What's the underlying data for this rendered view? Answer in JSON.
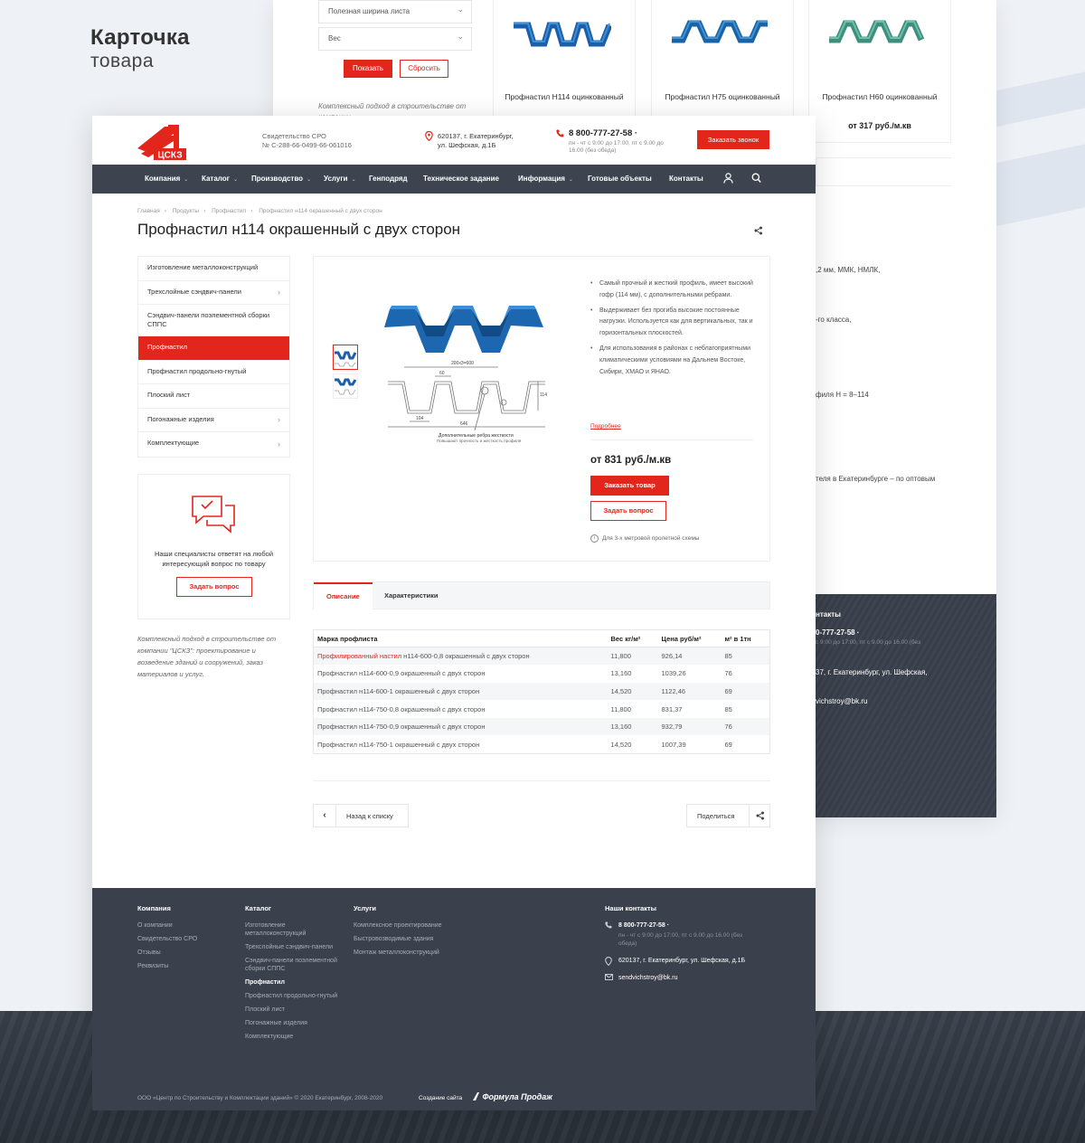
{
  "colors": {
    "accent": "#e3261c",
    "nav": "#3d4450",
    "footer": "#3a414c"
  },
  "presentation": {
    "title": "Карточка",
    "subtitle": "товара"
  },
  "back": {
    "filters": [
      "Полезная ширина листа",
      "Вес"
    ],
    "show_label": "Показать",
    "reset_label": "Сбросить",
    "blurb": "Комплексный подход в строительстве от компании",
    "products": [
      {
        "name": "Профнастил Н114 оцинкованный",
        "price": ""
      },
      {
        "name": "Профнастил Н75 оцинкованный",
        "price": ""
      },
      {
        "name": "Профнастил Н60 оцинкованный",
        "price": "от 317 руб./м.кв"
      }
    ],
    "snippets": [
      ",2 мм, ММК, НМЛК,",
      "-го класса,",
      "филя H = 8–114",
      "теля в Екатеринбурге – по оптовым"
    ],
    "dark": {
      "title": "нтакты",
      "phone": "0-777-27-58 ·",
      "hours": "с 9:00 до 17:00, пт с 9.00 до 16.00 (без",
      "addr": "37, г. Екатеринбург, ул. Шефская,",
      "email": "vichstroy@bk.ru"
    }
  },
  "header": {
    "cert_line1": "Свидетельство СРО",
    "cert_line2": "№ С-288-66-0499-66-061016",
    "addr_line1": "620137, г. Екатеринбург,",
    "addr_line2": "ул. Шефская, д.1Б",
    "phone": "8 800-777-27-58 ·",
    "hours": "пн - чт с 9:00 до 17:00, пт с 9.00 до 16.00 (без обеда)",
    "call_label": "Заказать звонок"
  },
  "nav": [
    {
      "label": "Компания",
      "chev": "⌄"
    },
    {
      "label": "Каталог",
      "chev": "⌄"
    },
    {
      "label": "Производство",
      "chev": "⌄"
    },
    {
      "label": "Услуги",
      "chev": "⌄"
    },
    {
      "label": "Генподряд",
      "chev": ""
    },
    {
      "label": "Техническое задание",
      "chev": ""
    },
    {
      "label": "Информация",
      "chev": "⌄"
    },
    {
      "label": "Готовые объекты",
      "chev": ""
    },
    {
      "label": "Контакты",
      "chev": ""
    }
  ],
  "breadcrumbs": [
    "Главная",
    "Продукты",
    "Профнастил",
    "Профнастил н114 окрашенный с двух сторон"
  ],
  "title": "Профнастил н114 окрашенный с двух сторон",
  "sidebar": [
    {
      "label": "Изготовление металлоконструкций",
      "arrow": ""
    },
    {
      "label": "Трехслойные сэндвич-панели",
      "arrow": "›"
    },
    {
      "label": "Сэндвич-панели поэлементной сборки СППС",
      "arrow": ""
    },
    {
      "label": "Профнастил",
      "arrow": ""
    },
    {
      "label": "Профнастил продольно-гнутый",
      "arrow": ""
    },
    {
      "label": "Плоский лист",
      "arrow": ""
    },
    {
      "label": "Погонажные изделия",
      "arrow": "›"
    },
    {
      "label": "Комплектующие",
      "arrow": "›"
    }
  ],
  "help": {
    "text": "Наши специалисты ответят на любой интересующий вопрос по товару",
    "button": "Задать вопрос"
  },
  "side_blurb": "Комплексный подход в строительстве от компании \"ЦСКЗ\": проектирование и возведение зданий и сооружений, заказ материалов и услуг.",
  "product": {
    "bullets": [
      "Самый прочный и жесткий профиль, имеет высокий гофр (114 мм), с дополнительными ребрами.",
      "Выдерживает без прогиба высокие постоянные нагрузки. Используется как для вертикальных, так и горизонтальных плоскостей.",
      "Для использования в районах с неблагоприятными климатическими условиями на Дальнем Востоке, Сибири, ХМАО и ЯНАО."
    ],
    "more": "Подробнее",
    "price": "от 831 руб./м.кв",
    "order": "Заказать товар",
    "ask": "Задать вопрос",
    "note": "Для 3-х метровой пролетной схемы",
    "drawing": {
      "dim1": "200х3=600",
      "dim2": "60",
      "dim3": "114",
      "dim4": "104",
      "dim5": "646",
      "cap1": "Дополнительные ребра жесткости",
      "cap2": "Повышают прочность и жесткость профиля"
    }
  },
  "tabs": [
    "Описание",
    "Характеристики"
  ],
  "table": {
    "headers": [
      "Марка профлиста",
      "Вес кг/м²",
      "Цена руб/м²",
      "м² в 1тн"
    ],
    "rows": [
      {
        "link": "Профилированный настил",
        "name": " н114-600-0,8 окрашенный с двух сторон",
        "w": "11,800",
        "p": "926,14",
        "q": "85"
      },
      {
        "link": "",
        "name": "Профнастил н114-600-0,9 окрашенный с двух сторон",
        "w": "13,160",
        "p": "1039,26",
        "q": "76"
      },
      {
        "link": "",
        "name": "Профнастил н114-600-1 окрашенный с двух сторон",
        "w": "14,520",
        "p": "1122,46",
        "q": "69"
      },
      {
        "link": "",
        "name": "Профнастил н114-750-0,8 окрашенный с двух сторон",
        "w": "11,800",
        "p": "831,37",
        "q": "85"
      },
      {
        "link": "",
        "name": "Профнастил н114-750-0,9 окрашенный с двух сторон",
        "w": "13,160",
        "p": "932,79",
        "q": "76"
      },
      {
        "link": "",
        "name": "Профнастил н114-750-1 окрашенный с двух сторон",
        "w": "14,520",
        "p": "1007,39",
        "q": "69"
      }
    ]
  },
  "back_label": "Назад к списку",
  "share_label": "Поделиться",
  "footer": {
    "company": {
      "title": "Компания",
      "items": [
        "О компании",
        "Свидетельство СРО",
        "Отзывы",
        "Реквизиты"
      ]
    },
    "catalog": {
      "title": "Каталог",
      "items": [
        "Изготовление металлоконструкций",
        "Трехслойные сэндвич-панели",
        "Сэндвич-панели поэлементной сборки СППС",
        "Профнастил",
        "Профнастил продольно-гнутый",
        "Плоский лист",
        "Погонажные изделия",
        "Комплектующие"
      ]
    },
    "services": {
      "title": "Услуги",
      "items": [
        "Комплексное проектирование",
        "Быстровозводимые здания",
        "Монтаж металлоконструкций"
      ]
    },
    "contacts": {
      "title": "Наши контакты",
      "phone": "8 800-777-27-58 ·",
      "hours": "пн - чт с 9:00 до 17:00, пт с 9.00 до 16.00 (без обеда)",
      "address": "620137, г. Екатеринбург, ул. Шефская, д.1Б",
      "email": "sendvichstroy@bk.ru"
    },
    "copyright": "ООО «Центр по Строительству и Комплектации зданий» © 2020 Екатеринбург, 2008-2020",
    "made": "Создание сайта",
    "brand": "Формула Продаж"
  },
  "logo_text": "ЦСКЗ"
}
